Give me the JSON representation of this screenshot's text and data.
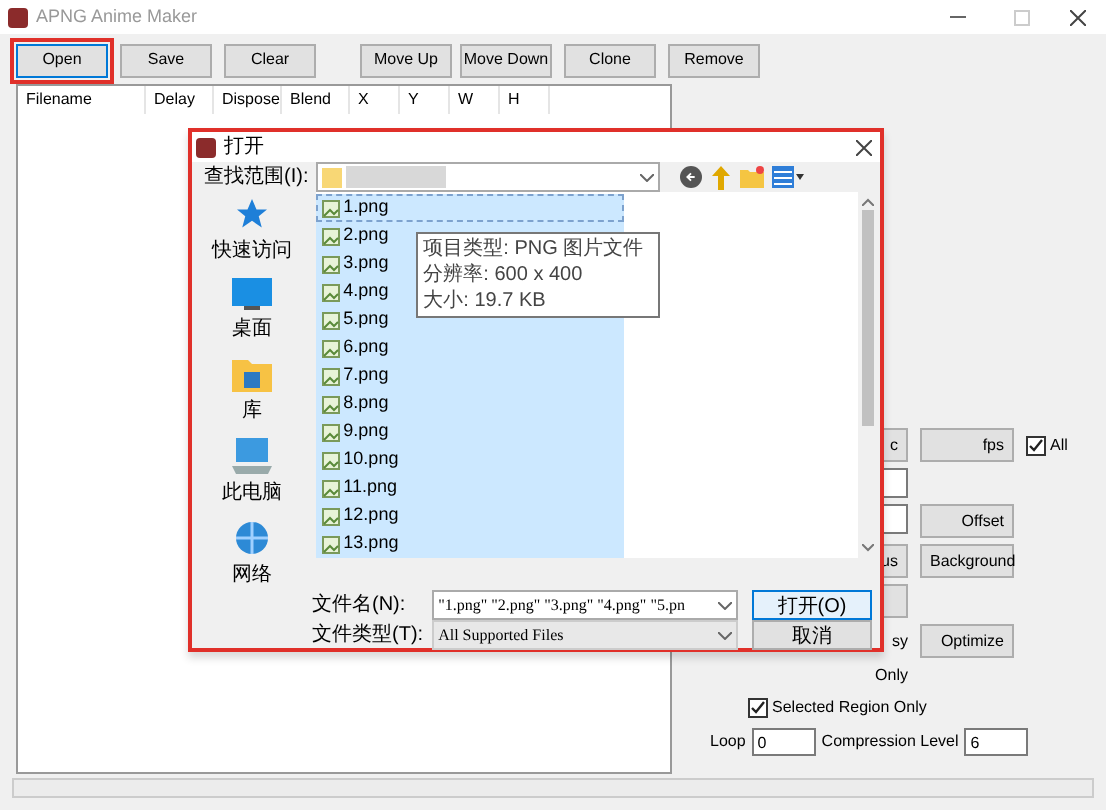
{
  "window": {
    "title": "APNG Anime Maker"
  },
  "toolbar": [
    {
      "label": "Open",
      "focused": true
    },
    {
      "label": "Save",
      "focused": false
    },
    {
      "label": "Clear",
      "focused": false
    },
    {
      "label": "Move Up",
      "focused": false
    },
    {
      "label": "Move Down",
      "focused": false
    },
    {
      "label": "Clone",
      "focused": false
    },
    {
      "label": "Remove",
      "focused": false
    }
  ],
  "frame_list": {
    "columns": [
      "Filename",
      "Delay",
      "Dispose",
      "Blend",
      "X",
      "Y",
      "W",
      "H"
    ]
  },
  "side_rows": [
    [
      {
        "kind": "button",
        "label": "c"
      },
      {
        "kind": "button",
        "label": "fps"
      },
      {
        "kind": "checkbox",
        "label": "All",
        "checked": true
      }
    ],
    [
      {
        "kind": "field"
      }
    ],
    [
      {
        "kind": "field"
      },
      {
        "kind": "button",
        "label": "Offset"
      }
    ],
    [
      {
        "kind": "button",
        "label": "us"
      },
      {
        "kind": "button",
        "label": "Background"
      }
    ],
    [
      {
        "kind": "button"
      }
    ],
    [
      {
        "kind": "text",
        "label": "sy"
      },
      {
        "kind": "button",
        "label": "Optimize"
      }
    ],
    [
      {
        "kind": "text",
        "label": "Only"
      }
    ]
  ],
  "selected_region": {
    "label": "Selected Region Only",
    "checked": true
  },
  "loop": {
    "label": "Loop",
    "value": "0"
  },
  "compression": {
    "label": "Compression Level",
    "value": "6"
  },
  "dialog": {
    "title": "打开",
    "look_in_label": "查找范围(I):",
    "places": [
      {
        "kind": "star",
        "label": "快速访问"
      },
      {
        "kind": "desktop",
        "label": "桌面"
      },
      {
        "kind": "library",
        "label": "库"
      },
      {
        "kind": "computer",
        "label": "此电脑"
      },
      {
        "kind": "network",
        "label": "网络"
      }
    ],
    "files": [
      {
        "name": "1.png",
        "selected": true
      },
      {
        "name": "2.png",
        "selected": true
      },
      {
        "name": "3.png",
        "selected": true
      },
      {
        "name": "4.png",
        "selected": true
      },
      {
        "name": "5.png",
        "selected": true
      },
      {
        "name": "6.png",
        "selected": true
      },
      {
        "name": "7.png",
        "selected": true
      },
      {
        "name": "8.png",
        "selected": true
      },
      {
        "name": "9.png",
        "selected": true
      },
      {
        "name": "10.png",
        "selected": true
      },
      {
        "name": "11.png",
        "selected": true
      },
      {
        "name": "12.png",
        "selected": true
      },
      {
        "name": "13.png",
        "selected": true
      }
    ],
    "tooltip": [
      "项目类型: PNG 图片文件",
      "分辨率: 600 x 400",
      "大小: 19.7 KB"
    ],
    "file_name_label": "文件名(N):",
    "file_name_value": "\"1.png\" \"2.png\" \"3.png\" \"4.png\" \"5.pn",
    "file_type_label": "文件类型(T):",
    "file_type_value": "All Supported Files",
    "open_button": "打开(O)",
    "cancel_button": "取消"
  }
}
